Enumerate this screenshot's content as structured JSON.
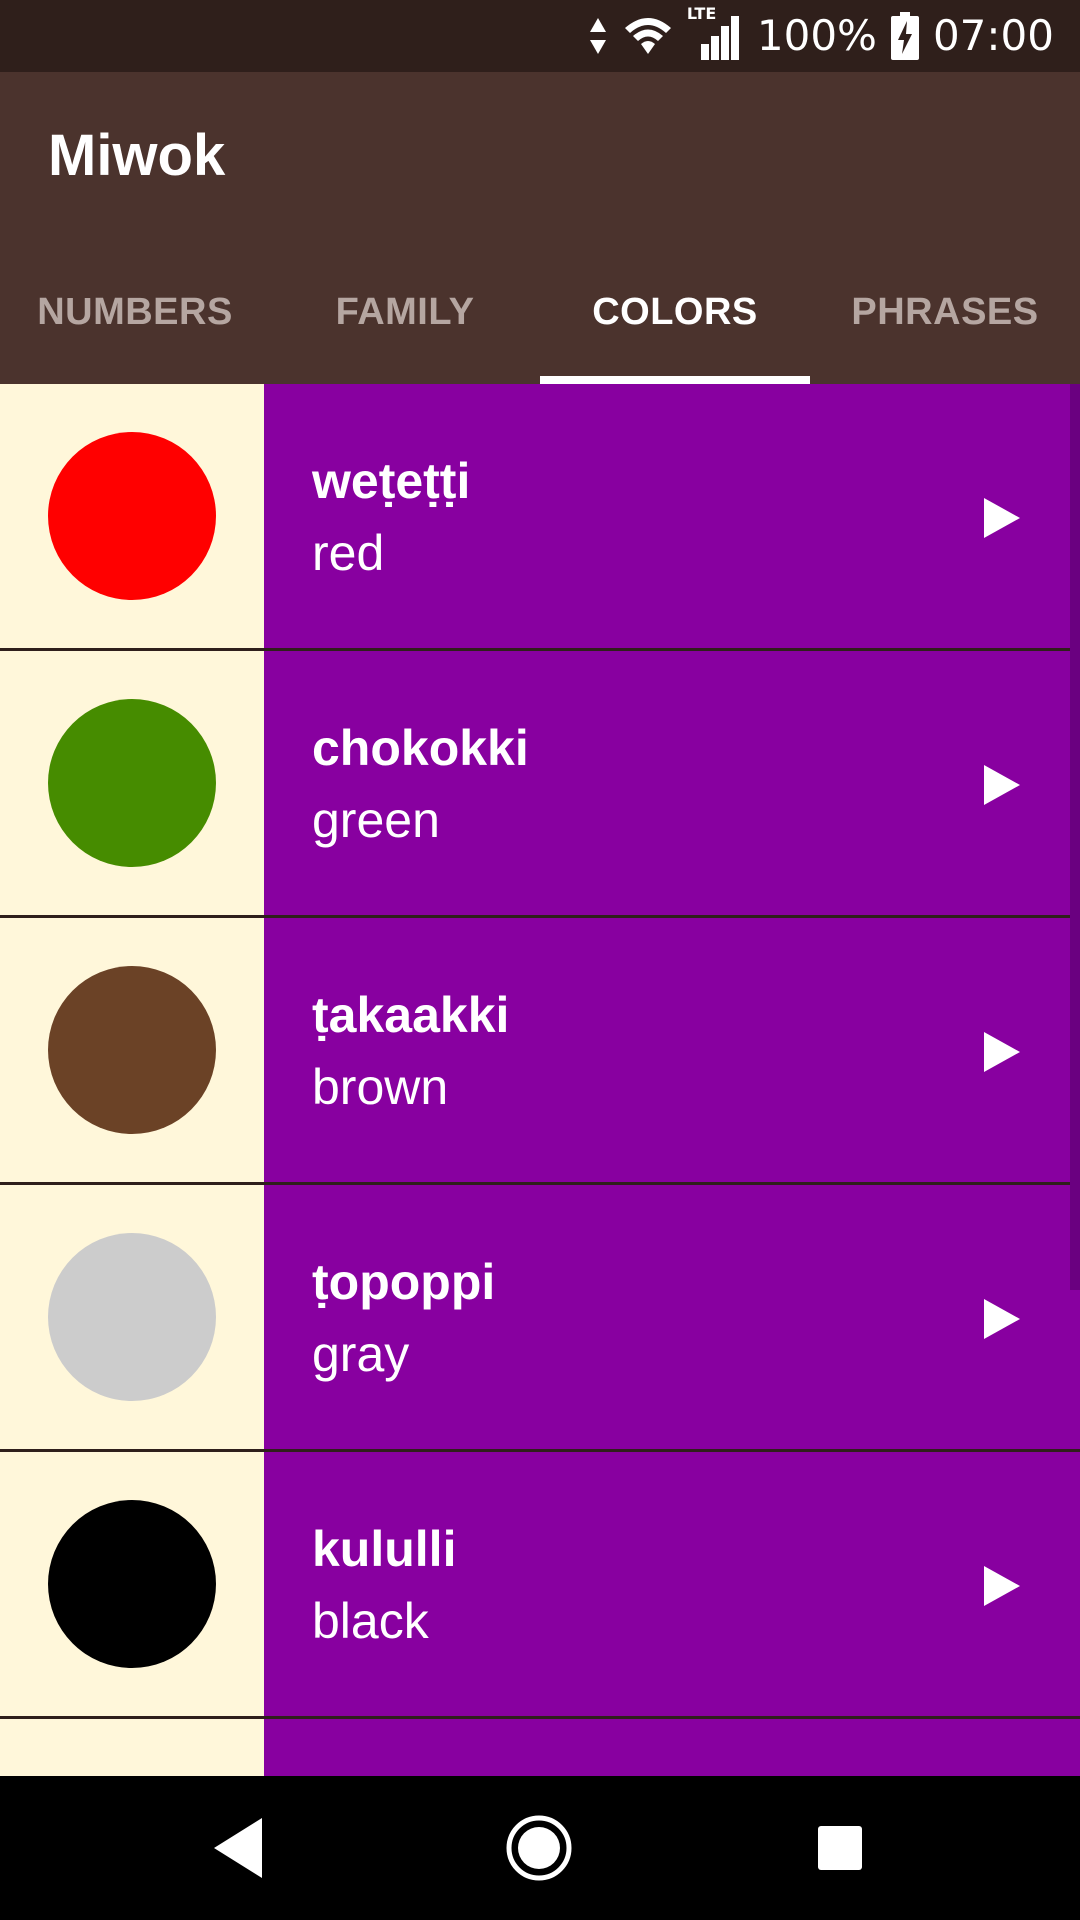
{
  "status_bar": {
    "battery": "100%",
    "time": "07:00",
    "network_label": "LTE",
    "icons": [
      "data-arrows-icon",
      "wifi-icon",
      "lte-signal-icon",
      "battery-charging-icon"
    ]
  },
  "app_bar": {
    "title": "Miwok",
    "background": "#4B332D",
    "tabs": [
      {
        "label": "NUMBERS",
        "active": false
      },
      {
        "label": "FAMILY",
        "active": false
      },
      {
        "label": "COLORS",
        "active": true
      },
      {
        "label": "PHRASES",
        "active": false
      }
    ]
  },
  "list": {
    "text_background": "#8800A0",
    "image_background": "#FFF7DA",
    "items": [
      {
        "miwok": "weṭeṭṭi",
        "english": "red",
        "color": "#FF0000",
        "icon": "play-icon"
      },
      {
        "miwok": "chokokki",
        "english": "green",
        "color": "#468C00",
        "icon": "play-icon"
      },
      {
        "miwok": "ṭakaakki",
        "english": "brown",
        "color": "#6B4226",
        "icon": "play-icon"
      },
      {
        "miwok": "ṭopoppi",
        "english": "gray",
        "color": "#CCCCCC",
        "icon": "play-icon"
      },
      {
        "miwok": "kululli",
        "english": "black",
        "color": "#000000",
        "icon": "play-icon"
      }
    ]
  },
  "nav_bar": {
    "icons": [
      "back-icon",
      "home-icon",
      "recents-icon"
    ]
  }
}
